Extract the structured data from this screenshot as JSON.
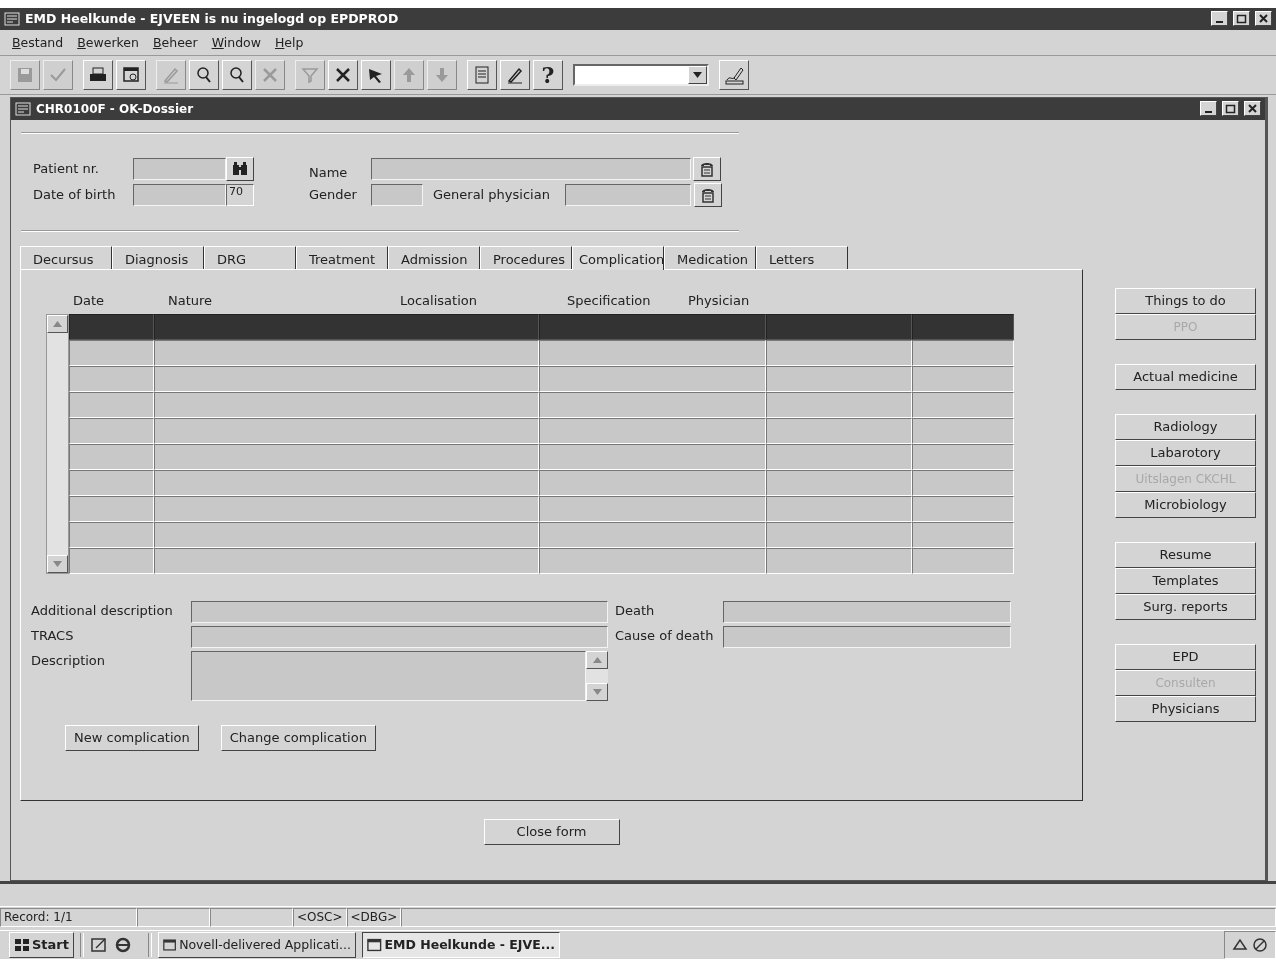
{
  "window": {
    "title": "EMD Heelkunde - EJVEEN is nu ingelogd op EPDPROD"
  },
  "menu": [
    "Bestand",
    "Bewerken",
    "Beheer",
    "Window",
    "Help"
  ],
  "toolbar": {
    "groups": [
      [
        {
          "kind": "save",
          "disabled": true
        },
        {
          "kind": "check",
          "disabled": true
        }
      ],
      [
        {
          "kind": "print",
          "disabled": false
        },
        {
          "kind": "preview",
          "disabled": false
        }
      ],
      [
        {
          "kind": "pen",
          "disabled": true
        },
        {
          "kind": "query",
          "disabled": false
        },
        {
          "kind": "query",
          "disabled": false
        },
        {
          "kind": "cross",
          "disabled": true
        }
      ],
      [
        {
          "kind": "filter",
          "disabled": true
        },
        {
          "kind": "cross",
          "disabled": false
        },
        {
          "kind": "pointer",
          "disabled": false
        },
        {
          "kind": "up",
          "disabled": true
        },
        {
          "kind": "down",
          "disabled": true
        }
      ],
      [
        {
          "kind": "list",
          "disabled": false
        },
        {
          "kind": "sign",
          "disabled": false
        },
        {
          "kind": "help",
          "disabled": false,
          "label": "?"
        }
      ],
      [
        {
          "kind": "combo"
        }
      ],
      [
        {
          "kind": "signature",
          "disabled": false
        }
      ]
    ]
  },
  "form": {
    "title": "CHR0100F - OK-Dossier",
    "header_fields": {
      "patient_nr": {
        "label": "Patient nr."
      },
      "date_of_birth": {
        "label": "Date of birth",
        "age": "70"
      },
      "name": {
        "label": "Name"
      },
      "gender": {
        "label": "Gender"
      },
      "general_physician": {
        "label": "General physician"
      }
    },
    "tabs": [
      {
        "label": "Decursus",
        "selected": false
      },
      {
        "label": "Diagnosis",
        "selected": false
      },
      {
        "label": "DRG",
        "selected": false
      },
      {
        "label": "Treatment",
        "selected": false
      },
      {
        "label": "Admission",
        "selected": false
      },
      {
        "label": "Procedures",
        "selected": false
      },
      {
        "label": "Complication",
        "selected": true
      },
      {
        "label": "Medication",
        "selected": false
      },
      {
        "label": "Letters",
        "selected": false
      }
    ],
    "table": {
      "columns": [
        "Date",
        "Nature",
        "Localisation",
        "Specification",
        "Physician"
      ],
      "rows": [
        {
          "selected": true
        },
        {
          "selected": false
        },
        {
          "selected": false
        },
        {
          "selected": false
        },
        {
          "selected": false
        },
        {
          "selected": false
        },
        {
          "selected": false
        },
        {
          "selected": false
        },
        {
          "selected": false
        },
        {
          "selected": false
        }
      ]
    },
    "detail_fields": {
      "additional_description": {
        "label": "Additional description"
      },
      "death": {
        "label": "Death"
      },
      "tracs": {
        "label": "TRACS"
      },
      "cause_of_death": {
        "label": "Cause of death"
      },
      "description": {
        "label": "Description"
      }
    },
    "actions": [
      "New complication",
      "Change complication"
    ],
    "close_button": "Close form"
  },
  "side_buttons": [
    {
      "buttons": [
        {
          "label": "Things to do",
          "disabled": false
        },
        {
          "label": "PPO",
          "disabled": true
        }
      ]
    },
    {
      "buttons": [
        {
          "label": "Actual medicine",
          "disabled": false
        }
      ]
    },
    {
      "buttons": [
        {
          "label": "Radiology",
          "disabled": false
        },
        {
          "label": "Labarotory",
          "disabled": false
        },
        {
          "label": "Uitslagen CKCHL",
          "disabled": true
        },
        {
          "label": "Microbiology",
          "disabled": false
        }
      ]
    },
    {
      "buttons": [
        {
          "label": "Resume",
          "disabled": false
        },
        {
          "label": "Templates",
          "disabled": false
        },
        {
          "label": "Surg. reports",
          "disabled": false
        }
      ]
    },
    {
      "buttons": [
        {
          "label": "EPD",
          "disabled": false
        },
        {
          "label": "Consulten",
          "disabled": true
        },
        {
          "label": "Physicians",
          "disabled": false
        }
      ]
    }
  ],
  "status_bar": {
    "record": "Record: 1/1",
    "flags": [
      "<OSC>",
      "<DBG>"
    ]
  },
  "taskbar": {
    "start": "Start",
    "tasks": [
      {
        "label": "Novell-delivered Applicati...",
        "selected": false
      },
      {
        "label": "EMD Heelkunde - EJVE...",
        "selected": true
      }
    ]
  }
}
